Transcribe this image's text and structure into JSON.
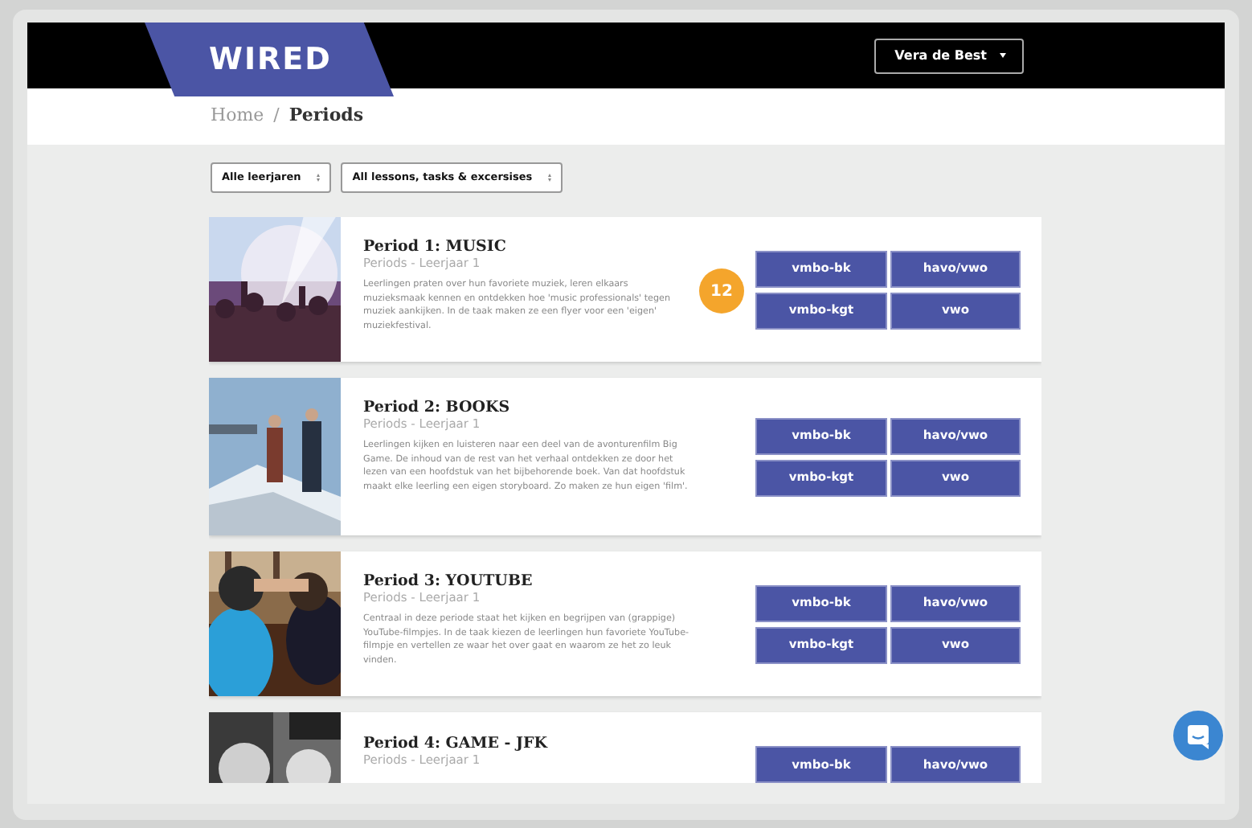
{
  "header": {
    "logo": "WIRED",
    "user_menu": "Vera de Best"
  },
  "breadcrumb": [
    {
      "label": "Home",
      "current": false
    },
    {
      "label": "/",
      "current": false
    },
    {
      "label": "Periods",
      "current": true
    }
  ],
  "filters": [
    {
      "value": "Alle leerjaren"
    },
    {
      "value": "All lessons, tasks & excersises"
    }
  ],
  "periods": [
    {
      "title": "Period 1: MUSIC",
      "subtitle": "Periods - Leerjaar 1",
      "description": "Leerlingen praten over hun favoriete muziek, leren elkaars muzieksmaak kennen en ontdekken hoe 'music professionals' tegen muziek aankijken. In de taak maken ze een flyer voor een 'eigen' muziekfestival.",
      "buttons": [
        "vmbo-bk",
        "havo/vwo",
        "vmbo-kgt",
        "vwo"
      ]
    },
    {
      "title": "Period 2: BOOKS",
      "subtitle": "Periods - Leerjaar 1",
      "description": "Leerlingen kijken en luisteren naar een deel van de avonturenfilm Big Game. De inhoud van de rest van het verhaal ontdekken ze door het lezen van een hoofdstuk van het bijbehorende boek. Van dat hoofdstuk maakt elke leerling een eigen storyboard. Zo maken ze hun eigen 'film'.",
      "buttons": [
        "vmbo-bk",
        "havo/vwo",
        "vmbo-kgt",
        "vwo"
      ]
    },
    {
      "title": "Period 3: YOUTUBE",
      "subtitle": "Periods - Leerjaar 1",
      "description": "Centraal in deze periode staat het kijken en begrijpen van (grappige) YouTube-filmpjes. In de taak kiezen de leerlingen hun favoriete YouTube-filmpje en vertellen ze waar het over gaat en waarom ze het zo leuk vinden.",
      "buttons": [
        "vmbo-bk",
        "havo/vwo",
        "vmbo-kgt",
        "vwo"
      ]
    },
    {
      "title": "Period 4: GAME - JFK",
      "subtitle": "Periods - Leerjaar 1",
      "buttons": [
        "vmbo-bk",
        "havo/vwo"
      ]
    }
  ],
  "callout_badge": "12"
}
